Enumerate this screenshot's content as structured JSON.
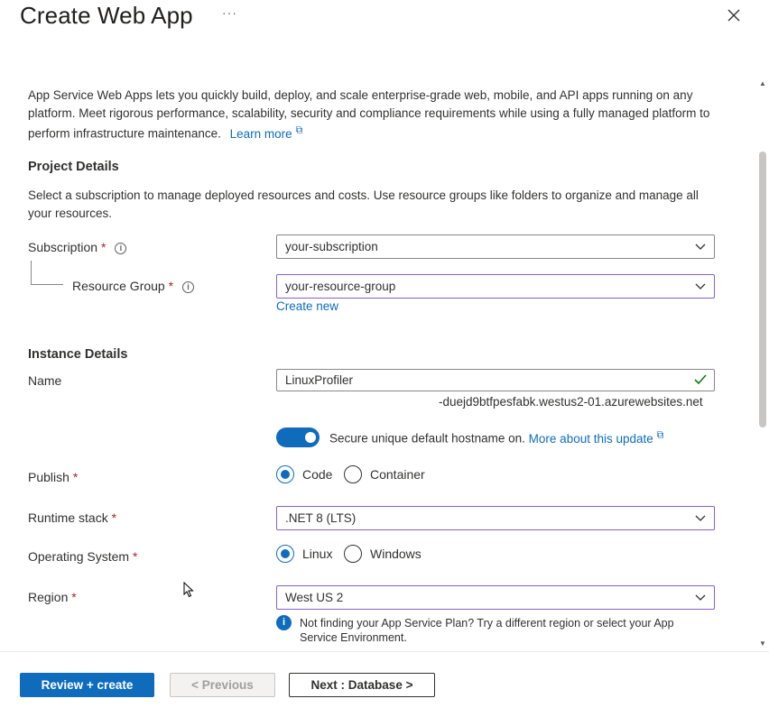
{
  "header": {
    "title": "Create Web App",
    "more_label": "···"
  },
  "intro": {
    "text": "App Service Web Apps lets you quickly build, deploy, and scale enterprise-grade web, mobile, and API apps running on any platform. Meet rigorous performance, scalability, security and compliance requirements while using a fully managed platform to perform infrastructure maintenance.",
    "learn_more": "Learn more"
  },
  "project_details": {
    "heading": "Project Details",
    "description": "Select a subscription to manage deployed resources and costs. Use resource groups like folders to organize and manage all your resources.",
    "subscription_label": "Subscription",
    "subscription_value": "your-subscription",
    "resource_group_label": "Resource Group",
    "resource_group_value": "your-resource-group",
    "create_new": "Create new"
  },
  "instance_details": {
    "heading": "Instance Details",
    "name_label": "Name",
    "name_value": "LinuxProfiler",
    "hostname_suffix": "-duejd9btfpesfabk.westus2-01.azurewebsites.net",
    "secure_hostname_text": "Secure unique default hostname on.",
    "secure_hostname_link": "More about this update",
    "publish_label": "Publish",
    "publish_options": [
      "Code",
      "Container"
    ],
    "publish_selected": "Code",
    "runtime_label": "Runtime stack",
    "runtime_value": ".NET 8 (LTS)",
    "os_label": "Operating System",
    "os_options": [
      "Linux",
      "Windows"
    ],
    "os_selected": "Linux",
    "region_label": "Region",
    "region_value": "West US 2",
    "region_info": "Not finding your App Service Plan? Try a different region or select your App Service Environment."
  },
  "required_marker": "*",
  "footer": {
    "review_create": "Review + create",
    "previous": "< Previous",
    "next": "Next : Database >"
  },
  "colors": {
    "accent": "#0f6cbd",
    "required": "#a4262c",
    "focus_border": "#8661c5",
    "valid": "#107c10"
  }
}
